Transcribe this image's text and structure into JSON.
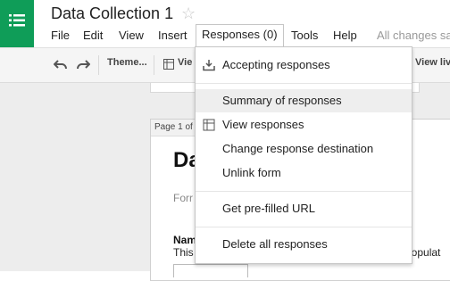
{
  "app": {
    "title": "Data Collection 1",
    "menu": [
      "File",
      "Edit",
      "View",
      "Insert",
      "Responses (0)",
      "Tools",
      "Help"
    ],
    "saved_status": "All changes sa"
  },
  "toolbar": {
    "theme_label": "Theme...",
    "view_label": "Vie",
    "view_live_label": "View liv"
  },
  "form": {
    "page_label": "Page 1 of",
    "title": "Da",
    "description": "Forr",
    "question_label": "Nam",
    "question_help": "This",
    "question_help_tail": "populat"
  },
  "responses_menu": {
    "accepting": "Accepting responses",
    "summary": "Summary of responses",
    "view": "View responses",
    "change_destination": "Change response destination",
    "unlink": "Unlink form",
    "prefilled": "Get pre-filled URL",
    "delete_all": "Delete all responses"
  },
  "colors": {
    "brand": "#0f9d58",
    "hover": "#eeeeee"
  }
}
